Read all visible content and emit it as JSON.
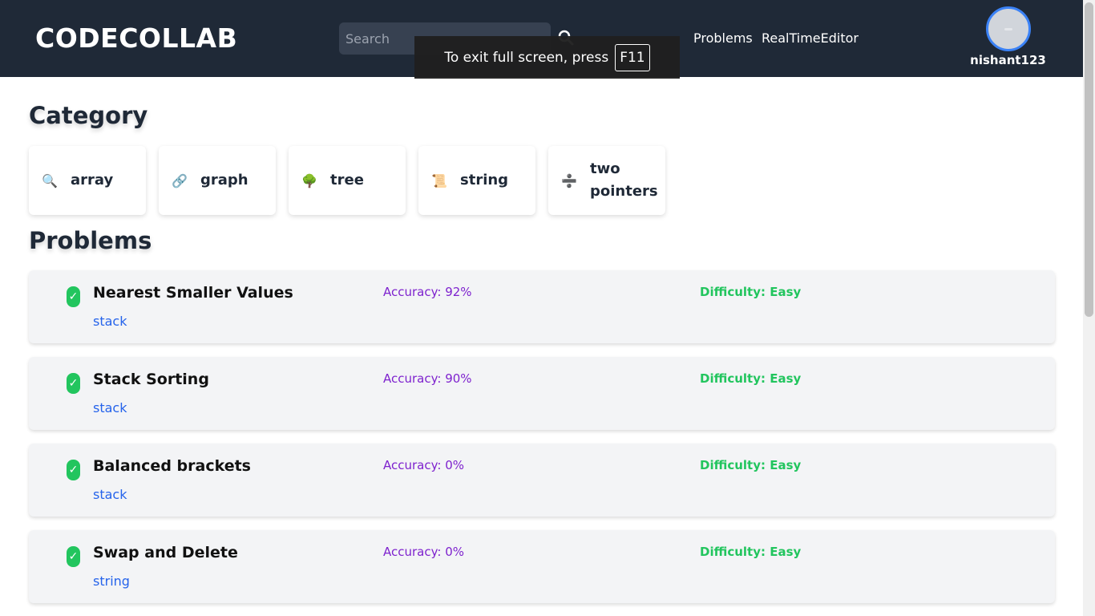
{
  "header": {
    "logo": "CODECOLLAB",
    "search_placeholder": "Search",
    "nav": {
      "problems": "Problems",
      "editor": "RealTimeEditor"
    },
    "username": "nishant123"
  },
  "fullscreen_notice": {
    "text": "To exit full screen, press",
    "key": "F11"
  },
  "category": {
    "title": "Category",
    "items": [
      {
        "label": "array",
        "icon": "magnifier-icon",
        "glyph": "🔍"
      },
      {
        "label": "graph",
        "icon": "link-icon",
        "glyph": "🔗"
      },
      {
        "label": "tree",
        "icon": "tree-icon",
        "glyph": "🌳"
      },
      {
        "label": "string",
        "icon": "scroll-icon",
        "glyph": "📜"
      },
      {
        "label": "two pointers",
        "icon": "divide-icon",
        "glyph": "➗"
      }
    ]
  },
  "problems": {
    "title": "Problems",
    "items": [
      {
        "title": "Nearest Smaller Values",
        "tag": "stack",
        "accuracy": "Accuracy: 92%",
        "difficulty": "Difficulty: Easy"
      },
      {
        "title": "Stack Sorting",
        "tag": "stack",
        "accuracy": "Accuracy: 90%",
        "difficulty": "Difficulty: Easy"
      },
      {
        "title": "Balanced brackets",
        "tag": "stack",
        "accuracy": "Accuracy: 0%",
        "difficulty": "Difficulty: Easy"
      },
      {
        "title": "Swap and Delete",
        "tag": "string",
        "accuracy": "Accuracy: 0%",
        "difficulty": "Difficulty: Easy"
      }
    ]
  },
  "colors": {
    "navbar": "#1f2937",
    "accuracy": "#7e22ce",
    "difficulty_easy": "#22c55e",
    "tag": "#2563eb",
    "check": "#22c55e"
  }
}
